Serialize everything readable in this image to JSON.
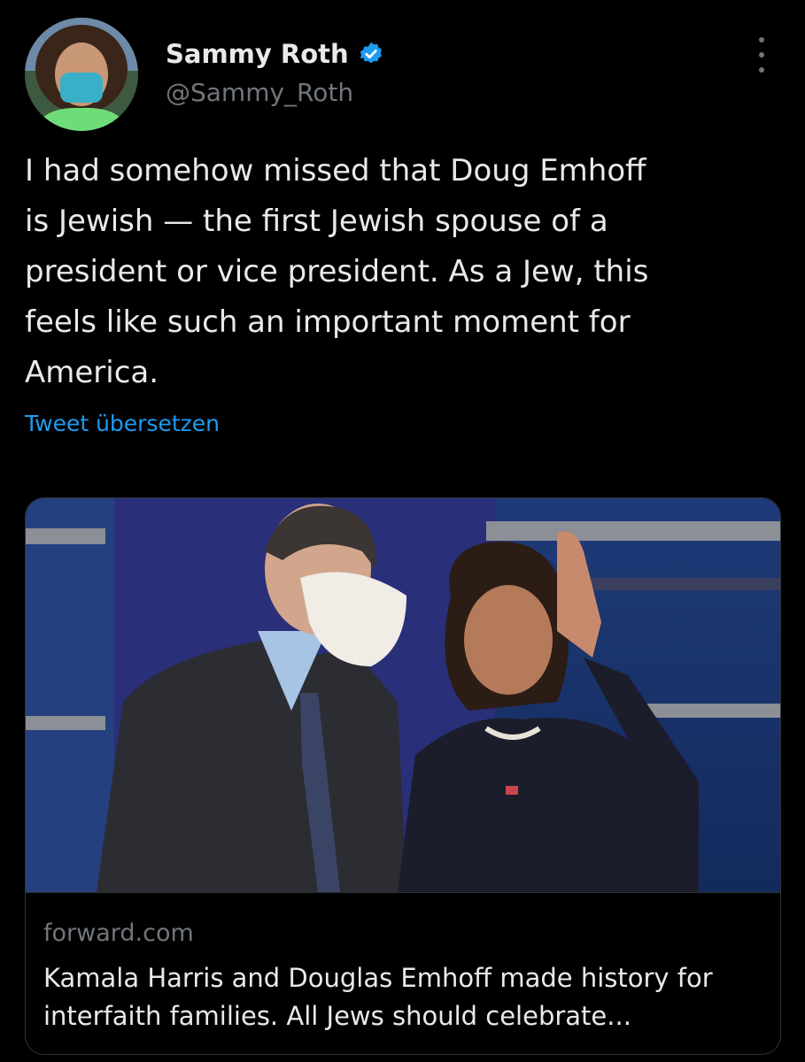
{
  "author": {
    "display_name": "Sammy Roth",
    "handle": "@Sammy_Roth",
    "verified": true
  },
  "tweet": {
    "text": "I had somehow missed that Doug Emhoff\nis Jewish — the first Jewish spouse of a\npresident or vice president. As a Jew, this\nfeels like such an important moment for\nAmerica.",
    "translate_label": "Tweet übersetzen"
  },
  "link_card": {
    "domain": "forward.com",
    "title": "Kamala Harris and Douglas Emhoff made history for interfaith families. All Jews should celebrate..."
  },
  "colors": {
    "background": "#000000",
    "text": "#e7e9ea",
    "secondary_text": "#71767b",
    "link": "#1d9bf0",
    "border": "#2f3336",
    "verified_badge": "#1d9bf0"
  }
}
